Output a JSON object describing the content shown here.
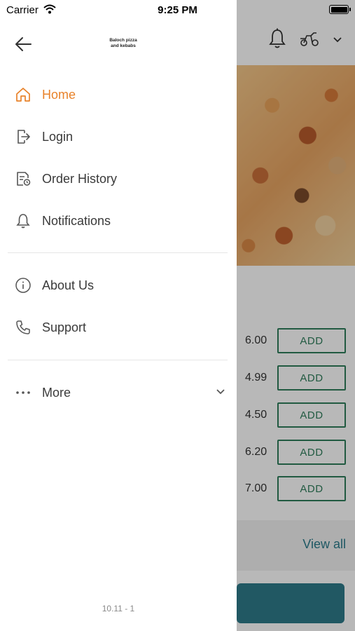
{
  "status_bar": {
    "carrier": "Carrier",
    "time": "9:25 PM"
  },
  "drawer": {
    "logo_text_line1": "Baloch pizza",
    "logo_text_line2": "and kebabs",
    "items": [
      {
        "label": "Home",
        "icon": "home-icon",
        "active": true
      },
      {
        "label": "Login",
        "icon": "login-icon"
      },
      {
        "label": "Order History",
        "icon": "order-history-icon"
      },
      {
        "label": "Notifications",
        "icon": "bell-icon"
      },
      {
        "label": "About Us",
        "icon": "info-icon"
      },
      {
        "label": "Support",
        "icon": "phone-icon"
      },
      {
        "label": "More",
        "icon": "more-dots-icon"
      }
    ],
    "version": "10.11 - 1"
  },
  "background": {
    "products": [
      {
        "price": "6.00",
        "button": "ADD"
      },
      {
        "price": "4.99",
        "button": "ADD"
      },
      {
        "price": "4.50",
        "button": "ADD"
      },
      {
        "price": "6.20",
        "button": "ADD"
      },
      {
        "price": "7.00",
        "button": "ADD"
      }
    ],
    "view_all": "View all"
  },
  "colors": {
    "accent": "#e8822a",
    "add_green": "#2f7d5b",
    "teal": "#2f7a8a"
  }
}
